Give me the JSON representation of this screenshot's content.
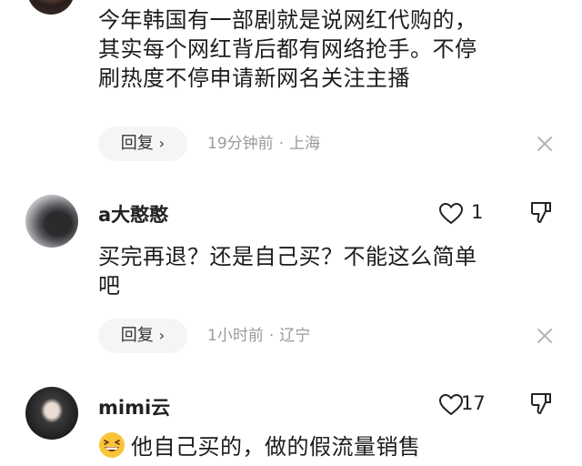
{
  "comments": [
    {
      "text_lines": [
        "今年韩国有一部剧就是说网红代购的，",
        "其实每个网红背后都有网络抢手。不停",
        "刷热度不停申请新网名关注主播"
      ],
      "reply_label": "回复",
      "time": "19分钟前",
      "location": "上海"
    },
    {
      "username": "a大憨憨",
      "likes": "1",
      "text_lines": [
        "买完再退？还是自己买？不能这么简单",
        "吧"
      ],
      "reply_label": "回复",
      "time": "1小时前",
      "location": "辽宁"
    },
    {
      "username": "mimi云",
      "likes": "17",
      "emoji": "grinning-squinting-face",
      "text": "他自己买的，做的假流量销售"
    }
  ],
  "icons": {
    "like": "heart-outline-icon",
    "dislike": "thumbs-down-outline-icon",
    "close": "close-icon",
    "reply_chevron": "chevron-right-icon"
  },
  "colors": {
    "meta_text": "#9a9a9a",
    "reply_bg": "#f5f5f5"
  }
}
